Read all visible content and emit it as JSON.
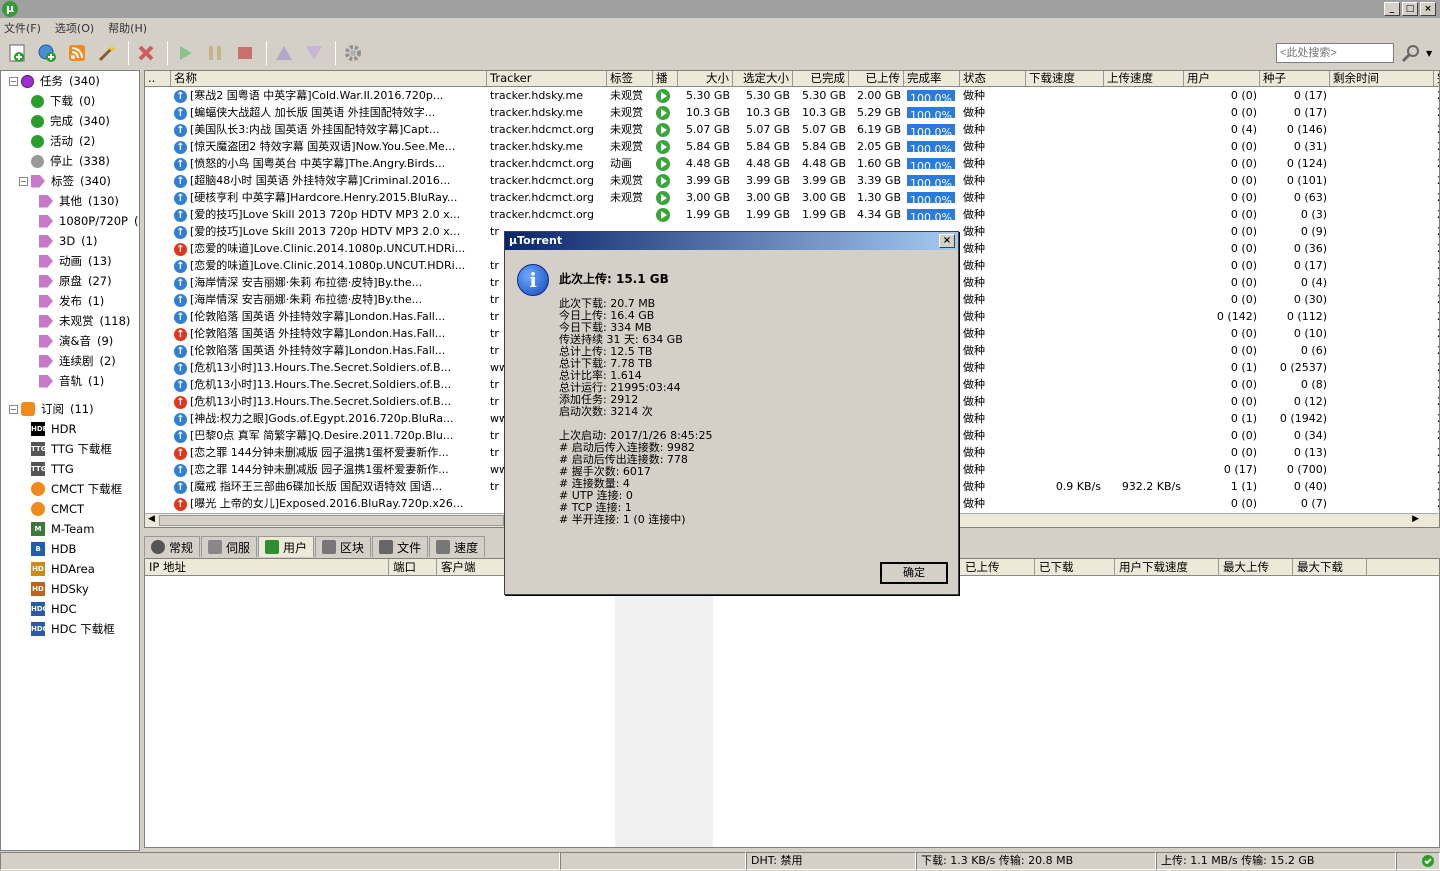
{
  "window": {
    "logo": "µ",
    "min": "_",
    "max": "□",
    "close": "×"
  },
  "menu": [
    "文件(F)",
    "选项(O)",
    "帮助(H)"
  ],
  "search": {
    "placeholder": "<此处搜索>"
  },
  "sidebar": {
    "tasks": {
      "label": "任务",
      "count": "(340)"
    },
    "states": [
      {
        "label": "下载",
        "count": "(0)",
        "color": "#2a9d2a"
      },
      {
        "label": "完成",
        "count": "(340)",
        "color": "#2a9d2a"
      },
      {
        "label": "活动",
        "count": "(2)",
        "color": "#2a9d2a"
      },
      {
        "label": "停止",
        "count": "(338)",
        "color": "#9a9a9a"
      }
    ],
    "labels_root": {
      "label": "标签",
      "count": "(340)"
    },
    "labels": [
      {
        "label": "其他",
        "count": "(130)"
      },
      {
        "label": "1080P/720P",
        "count": "(3"
      },
      {
        "label": "3D",
        "count": "(1)"
      },
      {
        "label": "动画",
        "count": "(13)"
      },
      {
        "label": "原盘",
        "count": "(27)"
      },
      {
        "label": "发布",
        "count": "(1)"
      },
      {
        "label": "未观赏",
        "count": "(118)"
      },
      {
        "label": "演&音",
        "count": "(9)"
      },
      {
        "label": "连续剧",
        "count": "(2)"
      },
      {
        "label": "音轨",
        "count": "(1)"
      }
    ],
    "rss_root": {
      "label": "订阅",
      "count": "(11)"
    },
    "feeds": [
      {
        "label": "HDR",
        "icon": "HDR",
        "color": "#000000"
      },
      {
        "label": "TTG 下载框",
        "icon": "TTG",
        "color": "#555555"
      },
      {
        "label": "TTG",
        "icon": "TTG",
        "color": "#555555"
      },
      {
        "label": "CMCT 下载框",
        "icon": "rss",
        "color": "#f08a1c"
      },
      {
        "label": "CMCT",
        "icon": "rss",
        "color": "#f08a1c"
      },
      {
        "label": "M-Team",
        "icon": "M",
        "color": "#3a7a3a"
      },
      {
        "label": "HDB",
        "icon": "B",
        "color": "#1f5fb0"
      },
      {
        "label": "HDArea",
        "icon": "HD",
        "color": "#d08a1a"
      },
      {
        "label": "HDSky",
        "icon": "HD",
        "color": "#c0641a"
      },
      {
        "label": "HDC",
        "icon": "HDC",
        "color": "#2a5ba8"
      },
      {
        "label": "HDC 下载框",
        "icon": "HDC",
        "color": "#2a5ba8"
      }
    ]
  },
  "columns": [
    "..",
    "名称",
    "Tracker",
    "标签",
    "播",
    "大小",
    "选定大小",
    "已完成",
    "已上传",
    "完成率",
    "状态",
    "下载速度",
    "上传速度",
    "用户",
    "种子",
    "剩余时间",
    "完"
  ],
  "torrents": [
    {
      "dir": "up",
      "name": "[寒战2 国粤语 中英字幕]Cold.War.II.2016.720p...",
      "tracker": "tracker.hdsky.me",
      "label": "未观赏",
      "play": true,
      "size": "5.30 GB",
      "sel": "5.30 GB",
      "done": "5.30 GB",
      "up": "2.00 GB",
      "pct": "100.0%",
      "status": "做种",
      "dl": "",
      "ul": "",
      "peers": "0 (0)",
      "seeds": "0 (17)",
      "added": "20"
    },
    {
      "dir": "up",
      "name": "[蝙蝠侠大战超人 加长版 国英语 外挂国配特效字...",
      "tracker": "tracker.hdsky.me",
      "label": "未观赏",
      "play": true,
      "size": "10.3 GB",
      "sel": "10.3 GB",
      "done": "10.3 GB",
      "up": "5.29 GB",
      "pct": "100.0%",
      "status": "做种",
      "dl": "",
      "ul": "",
      "peers": "0 (0)",
      "seeds": "0 (17)",
      "added": "20"
    },
    {
      "dir": "up",
      "name": "[美国队长3:内战 国英语 外挂国配特效字幕]Capt...",
      "tracker": "tracker.hdcmct.org",
      "label": "未观赏",
      "play": true,
      "size": "5.07 GB",
      "sel": "5.07 GB",
      "done": "5.07 GB",
      "up": "6.19 GB",
      "pct": "100.0%",
      "status": "做种",
      "dl": "",
      "ul": "",
      "peers": "0 (4)",
      "seeds": "0 (146)",
      "added": "20"
    },
    {
      "dir": "up",
      "name": "[惊天魔盗团2 特效字幕 国英双语]Now.You.See.Me...",
      "tracker": "tracker.hdsky.me",
      "label": "未观赏",
      "play": true,
      "size": "5.84 GB",
      "sel": "5.84 GB",
      "done": "5.84 GB",
      "up": "2.05 GB",
      "pct": "100.0%",
      "status": "做种",
      "dl": "",
      "ul": "",
      "peers": "0 (0)",
      "seeds": "0 (31)",
      "added": "20"
    },
    {
      "dir": "up",
      "name": "[愤怒的小鸟 国粤英台 中英字幕]The.Angry.Birds...",
      "tracker": "tracker.hdcmct.org",
      "label": "动画",
      "play": true,
      "size": "4.48 GB",
      "sel": "4.48 GB",
      "done": "4.48 GB",
      "up": "1.60 GB",
      "pct": "100.0%",
      "status": "做种",
      "dl": "",
      "ul": "",
      "peers": "0 (0)",
      "seeds": "0 (124)",
      "added": "20"
    },
    {
      "dir": "up",
      "name": "[超脑48小时 国英语 外挂特效字幕]Criminal.2016...",
      "tracker": "tracker.hdcmct.org",
      "label": "未观赏",
      "play": true,
      "size": "3.99 GB",
      "sel": "3.99 GB",
      "done": "3.99 GB",
      "up": "3.39 GB",
      "pct": "100.0%",
      "status": "做种",
      "dl": "",
      "ul": "",
      "peers": "0 (0)",
      "seeds": "0 (101)",
      "added": "20"
    },
    {
      "dir": "up",
      "name": "[硬核亨利 中英字幕]Hardcore.Henry.2015.BluRay...",
      "tracker": "tracker.hdcmct.org",
      "label": "未观赏",
      "play": true,
      "size": "3.00 GB",
      "sel": "3.00 GB",
      "done": "3.00 GB",
      "up": "1.30 GB",
      "pct": "100.0%",
      "status": "做种",
      "dl": "",
      "ul": "",
      "peers": "0 (0)",
      "seeds": "0 (63)",
      "added": "20"
    },
    {
      "dir": "up",
      "name": "[爱的技巧]Love Skill 2013 720p HDTV MP3 2.0 x...",
      "tracker": "tracker.hdcmct.org",
      "label": "",
      "play": true,
      "size": "1.99 GB",
      "sel": "1.99 GB",
      "done": "1.99 GB",
      "up": "4.34 GB",
      "pct": "100.0%",
      "status": "做种",
      "dl": "",
      "ul": "",
      "peers": "0 (0)",
      "seeds": "0 (3)",
      "added": "20"
    },
    {
      "dir": "up",
      "name": "[爱的技巧]Love Skill 2013 720p HDTV MP3 2.0 x...",
      "tracker": "tr",
      "label": "",
      "play": false,
      "size": "",
      "sel": "",
      "done": "",
      "up": "",
      "pct": "",
      "status": "做种",
      "dl": "",
      "ul": "",
      "peers": "0 (0)",
      "seeds": "0 (9)",
      "added": "20"
    },
    {
      "dir": "down",
      "name": "[恋爱的味道]Love.Clinic.2014.1080p.UNCUT.HDRi...",
      "tracker": "",
      "label": "",
      "play": false,
      "size": "",
      "sel": "",
      "done": "",
      "up": "",
      "pct": "",
      "status": "做种",
      "dl": "",
      "ul": "",
      "peers": "0 (0)",
      "seeds": "0 (36)",
      "added": "20"
    },
    {
      "dir": "up",
      "name": "[恋爱的味道]Love.Clinic.2014.1080p.UNCUT.HDRi...",
      "tracker": "tr",
      "label": "",
      "play": false,
      "size": "",
      "sel": "",
      "done": "",
      "up": "",
      "pct": "",
      "status": "做种",
      "dl": "",
      "ul": "",
      "peers": "0 (0)",
      "seeds": "0 (17)",
      "added": "20"
    },
    {
      "dir": "up",
      "name": "[海岸情深 安吉丽娜·朱莉 布拉德·皮特]By.the...",
      "tracker": "tr",
      "label": "",
      "play": false,
      "size": "",
      "sel": "",
      "done": "",
      "up": "",
      "pct": "",
      "status": "做种",
      "dl": "",
      "ul": "",
      "peers": "0 (0)",
      "seeds": "0 (4)",
      "added": "20"
    },
    {
      "dir": "up",
      "name": "[海岸情深 安吉丽娜·朱莉 布拉德·皮特]By.the...",
      "tracker": "tr",
      "label": "",
      "play": false,
      "size": "",
      "sel": "",
      "done": "",
      "up": "",
      "pct": "",
      "status": "做种",
      "dl": "",
      "ul": "",
      "peers": "0 (0)",
      "seeds": "0 (30)",
      "added": "20"
    },
    {
      "dir": "up",
      "name": "[伦敦陷落 国英语 外挂特效字幕]London.Has.Fall...",
      "tracker": "tr",
      "label": "",
      "play": false,
      "size": "",
      "sel": "",
      "done": "",
      "up": "",
      "pct": "",
      "status": "做种",
      "dl": "",
      "ul": "",
      "peers": "0 (142)",
      "seeds": "0 (112)",
      "added": "20"
    },
    {
      "dir": "down",
      "name": "[伦敦陷落 国英语 外挂特效字幕]London.Has.Fall...",
      "tracker": "tr",
      "label": "",
      "play": false,
      "size": "",
      "sel": "",
      "done": "",
      "up": "",
      "pct": "",
      "status": "做种",
      "dl": "",
      "ul": "",
      "peers": "0 (0)",
      "seeds": "0 (10)",
      "added": "20"
    },
    {
      "dir": "up",
      "name": "[伦敦陷落 国英语 外挂特效字幕]London.Has.Fall...",
      "tracker": "tr",
      "label": "",
      "play": false,
      "size": "",
      "sel": "",
      "done": "",
      "up": "",
      "pct": "",
      "status": "做种",
      "dl": "",
      "ul": "",
      "peers": "0 (0)",
      "seeds": "0 (6)",
      "added": "20"
    },
    {
      "dir": "up",
      "name": "[危机13小时]13.Hours.The.Secret.Soldiers.of.B...",
      "tracker": "ww",
      "label": "",
      "play": false,
      "size": "",
      "sel": "",
      "done": "",
      "up": "",
      "pct": "",
      "status": "做种",
      "dl": "",
      "ul": "",
      "peers": "0 (1)",
      "seeds": "0 (2537)",
      "added": "20"
    },
    {
      "dir": "up",
      "name": "[危机13小时]13.Hours.The.Secret.Soldiers.of.B...",
      "tracker": "tr",
      "label": "",
      "play": false,
      "size": "",
      "sel": "",
      "done": "",
      "up": "",
      "pct": "",
      "status": "做种",
      "dl": "",
      "ul": "",
      "peers": "0 (0)",
      "seeds": "0 (8)",
      "added": "20"
    },
    {
      "dir": "down",
      "name": "[危机13小时]13.Hours.The.Secret.Soldiers.of.B...",
      "tracker": "tr",
      "label": "",
      "play": false,
      "size": "",
      "sel": "",
      "done": "",
      "up": "",
      "pct": "",
      "status": "做种",
      "dl": "",
      "ul": "",
      "peers": "0 (0)",
      "seeds": "0 (12)",
      "added": "20"
    },
    {
      "dir": "up",
      "name": "[神战:权力之眼]Gods.of.Egypt.2016.720p.BluRa...",
      "tracker": "ww",
      "label": "",
      "play": false,
      "size": "",
      "sel": "",
      "done": "",
      "up": "",
      "pct": "",
      "status": "做种",
      "dl": "",
      "ul": "",
      "peers": "0 (1)",
      "seeds": "0 (1942)",
      "added": "20"
    },
    {
      "dir": "up",
      "name": "[巴黎0点 真军 简繁字幕]Q.Desire.2011.720p.Blu...",
      "tracker": "tr",
      "label": "",
      "play": false,
      "size": "",
      "sel": "",
      "done": "",
      "up": "",
      "pct": "",
      "status": "做种",
      "dl": "",
      "ul": "",
      "peers": "0 (0)",
      "seeds": "0 (34)",
      "added": "20"
    },
    {
      "dir": "down",
      "name": "[恋之罪 144分钟未删减版 园子温携1蛋杯爱妻新作...",
      "tracker": "tr",
      "label": "",
      "play": false,
      "size": "",
      "sel": "",
      "done": "",
      "up": "",
      "pct": "",
      "status": "做种",
      "dl": "",
      "ul": "",
      "peers": "0 (0)",
      "seeds": "0 (13)",
      "added": "20"
    },
    {
      "dir": "up",
      "name": "[恋之罪 144分钟未删减版 园子温携1蛋杯爱妻新作...",
      "tracker": "ww",
      "label": "",
      "play": false,
      "size": "",
      "sel": "",
      "done": "",
      "up": "",
      "pct": "",
      "status": "做种",
      "dl": "",
      "ul": "",
      "peers": "0 (17)",
      "seeds": "0 (700)",
      "added": "20"
    },
    {
      "dir": "up",
      "name": "[魔戒 指环王三部曲6碟加长版 国配双语特效 国语...",
      "tracker": "tr",
      "label": "",
      "play": false,
      "size": "",
      "sel": "",
      "done": "",
      "up": "",
      "pct": "",
      "status": "做种",
      "dl": "0.9 KB/s",
      "ul": "932.2 KB/s",
      "peers": "1 (1)",
      "seeds": "0 (40)",
      "added": "20"
    },
    {
      "dir": "down",
      "name": "[曝光 上帝的女儿]Exposed.2016.BluRay.720p.x26...",
      "tracker": "",
      "label": "",
      "play": false,
      "size": "",
      "sel": "",
      "done": "",
      "up": "",
      "pct": "",
      "status": "做种",
      "dl": "",
      "ul": "",
      "peers": "0 (0)",
      "seeds": "0 (7)",
      "added": "20"
    }
  ],
  "tabs": [
    "常规",
    "伺服",
    "用户",
    "区块",
    "文件",
    "速度"
  ],
  "active_tab": 2,
  "peer_columns": [
    "IP 地址",
    "端口",
    "客户端"
  ],
  "peer_columns_right": [
    "已上传",
    "已下载",
    "用户下载速度",
    "最大上传",
    "最大下载"
  ],
  "statusbar": {
    "dht": "DHT: 禁用",
    "down": "下载: 1.3 KB/s 传输: 20.8 MB",
    "up": "上传: 1.1 MB/s 传输: 15.2 GB"
  },
  "dialog": {
    "title": "µTorrent",
    "headline": "此次上传: 15.1 GB",
    "lines": [
      "此次下载: 20.7 MB",
      "今日上传: 16.4 GB",
      "今日下载: 334 MB",
      "传送持续 31 天: 634 GB",
      "总计上传: 12.5 TB",
      "总计下载: 7.78 TB",
      "总计比率: 1.614",
      "总计运行: 21995:03:44",
      "添加任务: 2912",
      "启动次数: 3214 次",
      "",
      "上次启动: 2017/1/26 8:45:25",
      "# 启动后传入连接数: 9982",
      "# 启动后传出连接数: 778",
      "# 握手次数: 6017",
      "# 连接数量: 4",
      "# UTP 连接: 0",
      "# TCP 连接: 1",
      "# 半开连接: 1 (0 连接中)"
    ],
    "ok": "确定"
  }
}
